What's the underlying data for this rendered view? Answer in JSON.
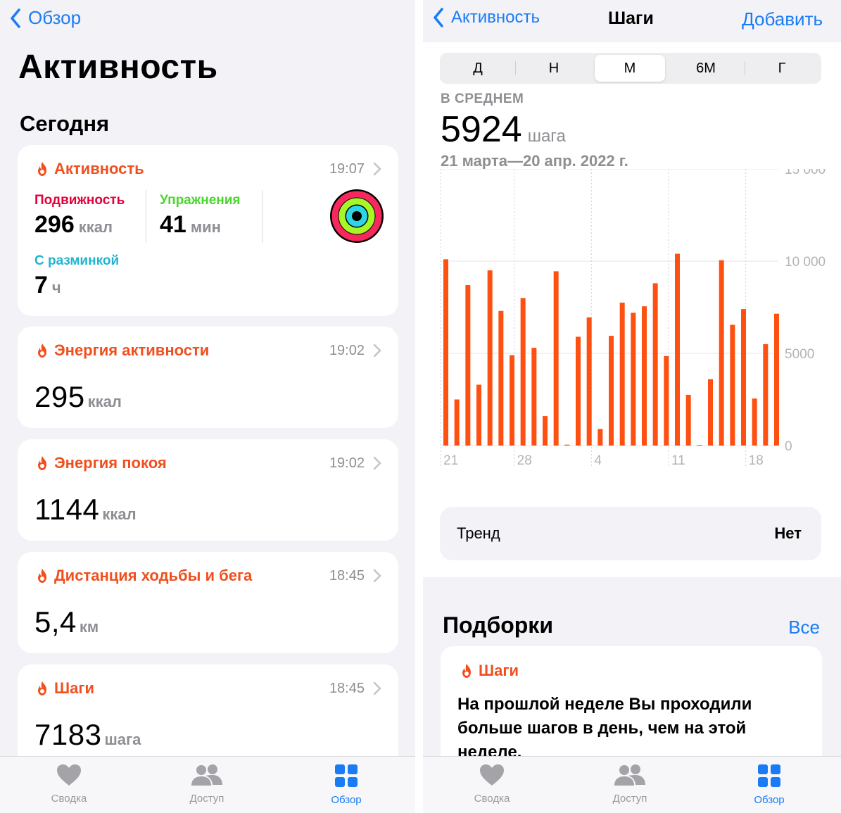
{
  "left": {
    "back_label": "Обзор",
    "title": "Активность",
    "section": "Сегодня",
    "activity_card": {
      "title": "Активность",
      "time": "19:07",
      "move": {
        "label": "Подвижность",
        "value": "296",
        "unit": "ккал",
        "color": "#e4003b"
      },
      "exercise": {
        "label": "Упражнения",
        "value": "41",
        "unit": "мин",
        "color": "#4ad62e"
      },
      "stand": {
        "label": "С разминкой",
        "value": "7",
        "unit": "ч",
        "color": "#20b4cf"
      }
    },
    "cards": [
      {
        "title": "Энергия активности",
        "time": "19:02",
        "value": "295",
        "unit": "ккал"
      },
      {
        "title": "Энергия покоя",
        "time": "19:02",
        "value": "1144",
        "unit": "ккал"
      },
      {
        "title": "Дистанция ходьбы и бега",
        "time": "18:45",
        "value": "5,4",
        "unit": "км"
      },
      {
        "title": "Шаги",
        "time": "18:45",
        "value": "7183",
        "unit": "шага"
      }
    ],
    "tabs": [
      {
        "label": "Сводка",
        "icon": "heart-icon"
      },
      {
        "label": "Доступ",
        "icon": "people-icon"
      },
      {
        "label": "Обзор",
        "icon": "grid-icon",
        "active": true
      }
    ]
  },
  "right": {
    "back_label": "Активность",
    "title": "Шаги",
    "action": "Добавить",
    "segments": [
      "Д",
      "Н",
      "М",
      "6М",
      "Г"
    ],
    "selected_segment": "М",
    "avg_label": "В СРЕДНЕМ",
    "avg_value": "5924",
    "avg_unit": "шага",
    "range": "21 марта—20 апр. 2022 г.",
    "trend": {
      "label": "Тренд",
      "value": "Нет"
    },
    "highlights": {
      "title": "Подборки",
      "all_label": "Все",
      "card_title": "Шаги",
      "card_text": "На прошлой неделе Вы проходили больше шагов в день, чем на этой неделе."
    },
    "tabs": [
      {
        "label": "Сводка",
        "icon": "heart-icon"
      },
      {
        "label": "Доступ",
        "icon": "people-icon"
      },
      {
        "label": "Обзор",
        "icon": "grid-icon",
        "active": true
      }
    ]
  },
  "accent": "#f04f1e",
  "link_color": "#1a7cf5",
  "chart_data": {
    "type": "bar",
    "x_ticks": [
      "21",
      "28",
      "4",
      "11",
      "18"
    ],
    "y_ticks": [
      "15 000",
      "10 000",
      "5000",
      "0"
    ],
    "ylim": [
      0,
      15000
    ],
    "grid": true,
    "color": "#fd5011",
    "categories": [
      "21",
      "22",
      "23",
      "24",
      "25",
      "26",
      "27",
      "28",
      "29",
      "30",
      "31",
      "1",
      "2",
      "3",
      "4",
      "5",
      "6",
      "7",
      "8",
      "9",
      "10",
      "11",
      "12",
      "13",
      "14",
      "15",
      "16",
      "17",
      "18",
      "19",
      "20"
    ],
    "values": [
      10100,
      2500,
      8700,
      3300,
      9500,
      7300,
      4900,
      8000,
      5300,
      1600,
      9450,
      50,
      5900,
      6950,
      900,
      5950,
      7750,
      7200,
      7550,
      8800,
      4850,
      10400,
      2750,
      30,
      3600,
      10050,
      6550,
      7400,
      2550,
      5500,
      7150
    ]
  }
}
